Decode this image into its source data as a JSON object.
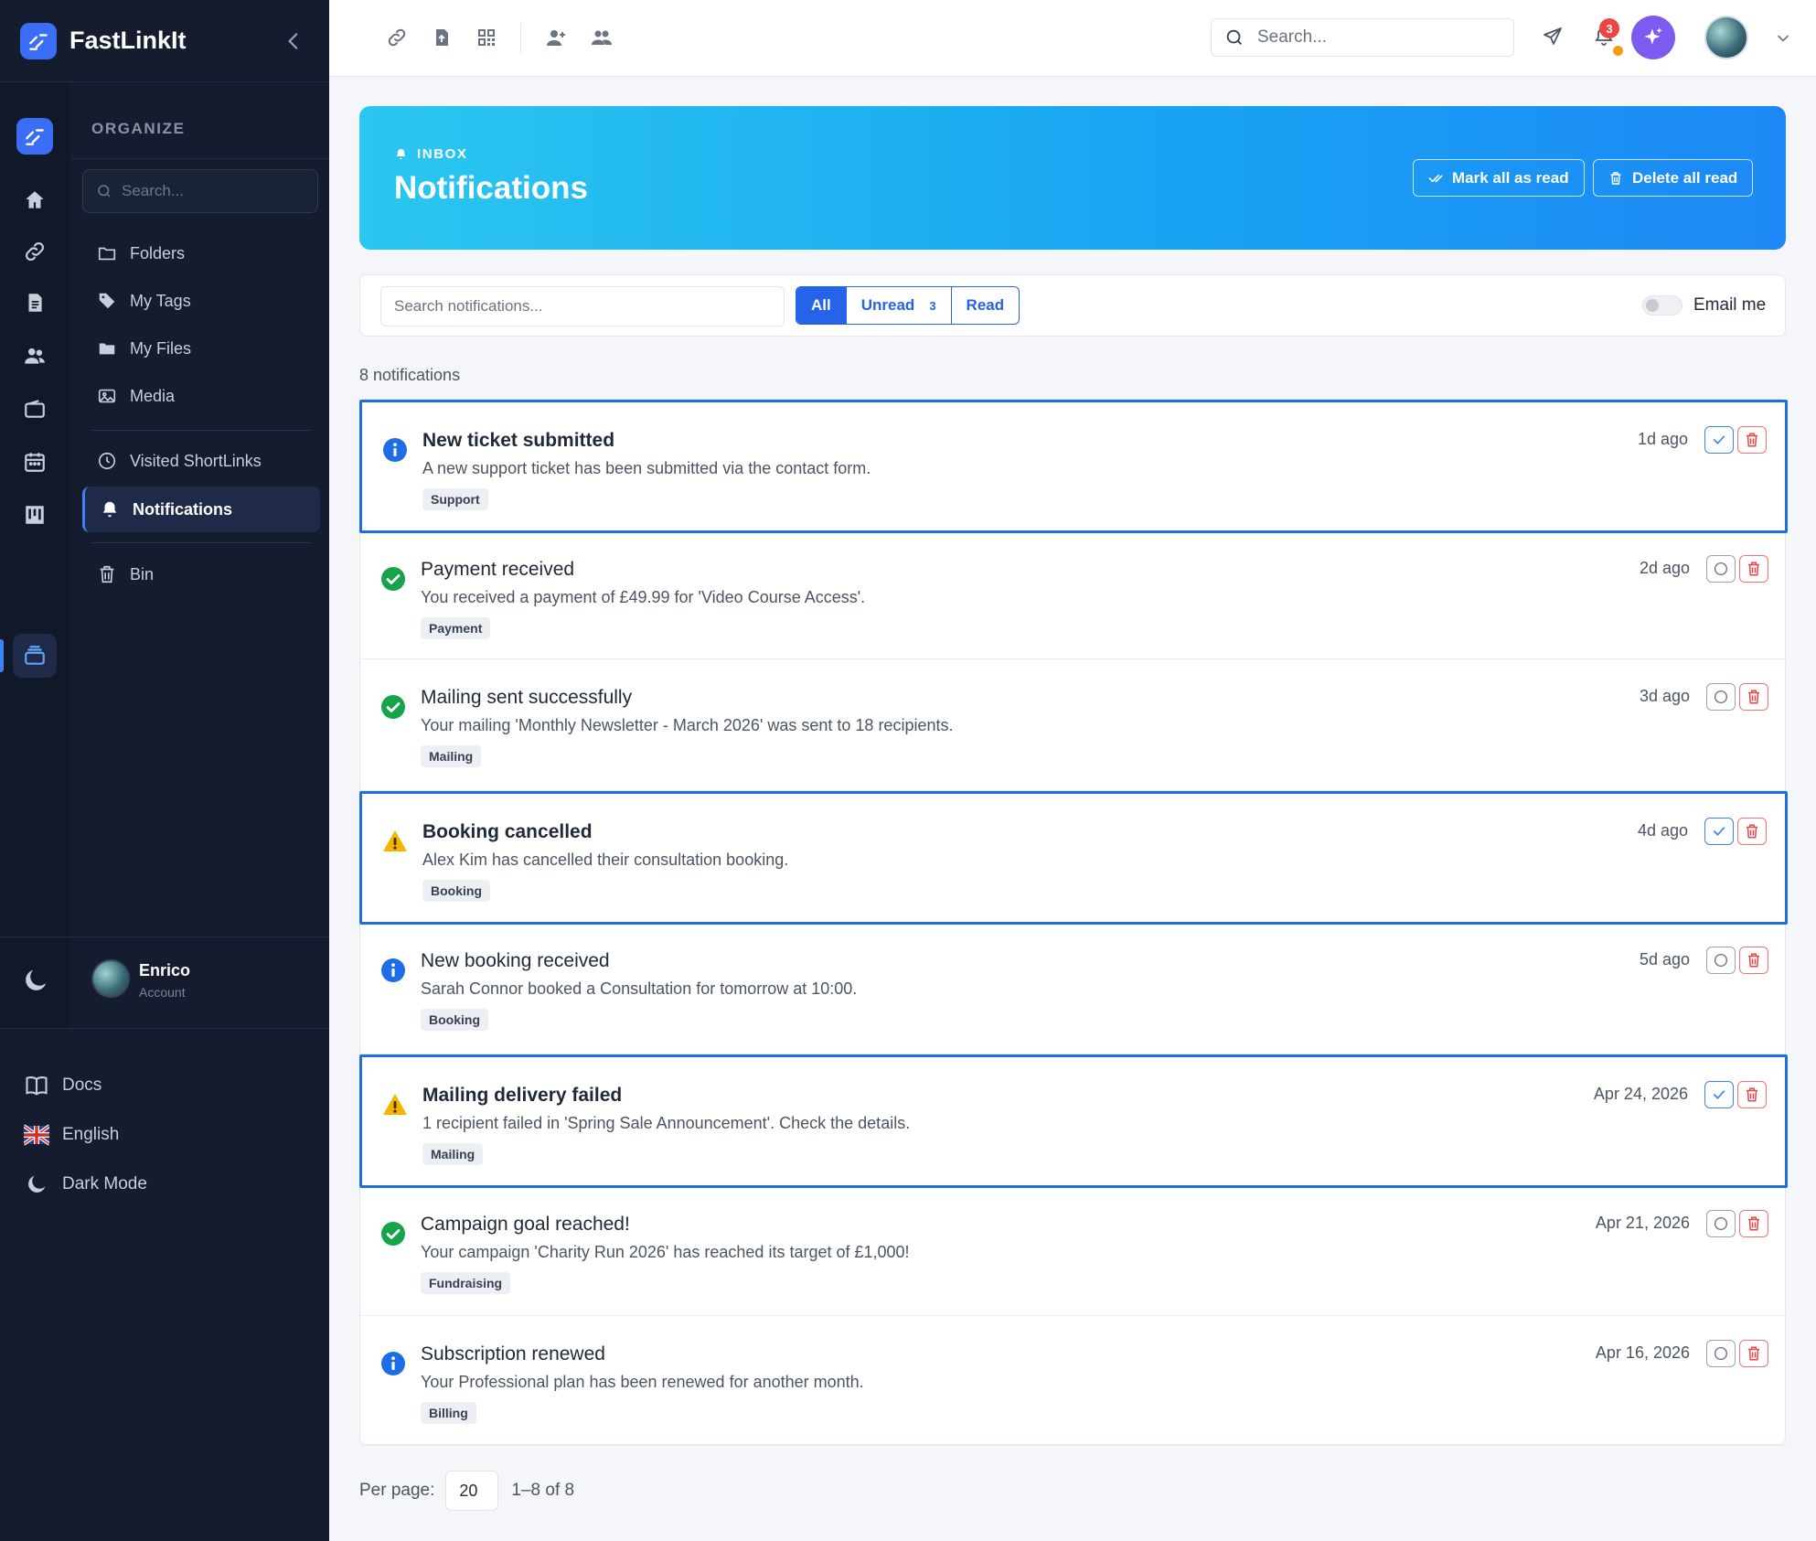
{
  "app": {
    "name": "FastLinkIt"
  },
  "sidebar": {
    "section_title": "ORGANIZE",
    "search_placeholder": "Search...",
    "items": [
      {
        "label": "Folders",
        "icon": "folder-icon"
      },
      {
        "label": "My Tags",
        "icon": "tag-icon"
      },
      {
        "label": "My Files",
        "icon": "folder-filled-icon"
      },
      {
        "label": "Media",
        "icon": "image-icon"
      },
      {
        "label": "Visited ShortLinks",
        "icon": "clock-icon"
      },
      {
        "label": "Notifications",
        "icon": "bell-icon",
        "active": true
      },
      {
        "label": "Bin",
        "icon": "trash-icon"
      }
    ],
    "user": {
      "name": "Enrico",
      "subtitle": "Account"
    },
    "bottom": {
      "docs": "Docs",
      "language": "English",
      "dark_mode": "Dark Mode"
    }
  },
  "topbar": {
    "search_placeholder": "Search...",
    "bell_badge": "3"
  },
  "hero": {
    "eyebrow": "INBOX",
    "title": "Notifications",
    "mark_all_label": "Mark all as read",
    "delete_all_label": "Delete all read"
  },
  "filters": {
    "search_placeholder": "Search notifications...",
    "all_label": "All",
    "unread_label": "Unread",
    "unread_count": "3",
    "read_label": "Read",
    "email_label": "Email me"
  },
  "count_text": "8 notifications",
  "notifications": [
    {
      "title": "New ticket submitted",
      "text": "A new support ticket has been submitted via the contact form.",
      "tag": "Support",
      "time": "1d ago",
      "type": "info",
      "unread": true
    },
    {
      "title": "Payment received",
      "text": "You received a payment of £49.99 for 'Video Course Access'.",
      "tag": "Payment",
      "time": "2d ago",
      "type": "success",
      "unread": false
    },
    {
      "title": "Mailing sent successfully",
      "text": "Your mailing 'Monthly Newsletter - March 2026' was sent to 18 recipients.",
      "tag": "Mailing",
      "time": "3d ago",
      "type": "success",
      "unread": false
    },
    {
      "title": "Booking cancelled",
      "text": "Alex Kim has cancelled their consultation booking.",
      "tag": "Booking",
      "time": "4d ago",
      "type": "warning",
      "unread": true
    },
    {
      "title": "New booking received",
      "text": "Sarah Connor booked a Consultation for tomorrow at 10:00.",
      "tag": "Booking",
      "time": "5d ago",
      "type": "info",
      "unread": false
    },
    {
      "title": "Mailing delivery failed",
      "text": "1 recipient failed in 'Spring Sale Announcement'. Check the details.",
      "tag": "Mailing",
      "time": "Apr 24, 2026",
      "type": "warning",
      "unread": true
    },
    {
      "title": "Campaign goal reached!",
      "text": "Your campaign 'Charity Run 2026' has reached its target of £1,000!",
      "tag": "Fundraising",
      "time": "Apr 21, 2026",
      "type": "success",
      "unread": false
    },
    {
      "title": "Subscription renewed",
      "text": "Your Professional plan has been renewed for another month.",
      "tag": "Billing",
      "time": "Apr 16, 2026",
      "type": "info",
      "unread": false
    }
  ],
  "pager": {
    "per_page_label": "Per page:",
    "per_page_value": "20",
    "range": "1–8 of 8"
  },
  "colors": {
    "accent": "#2563eb",
    "sidebar_bg": "#141c2e",
    "success": "#16a34a",
    "warning": "#f5b400",
    "info": "#1d6ee6",
    "danger": "#ef4444"
  }
}
